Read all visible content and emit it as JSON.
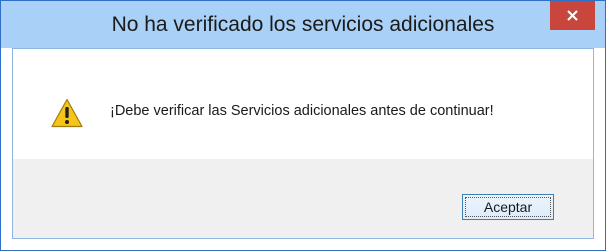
{
  "dialog": {
    "title": "No ha verificado los servicios adicionales",
    "message": "¡Debe verificar las Servicios adicionales antes de continuar!",
    "icon": "warning-icon",
    "ok_label": "Aceptar"
  },
  "colors": {
    "titlebar": "#a9d0f6",
    "close_button": "#c9463d",
    "footer": "#f0f0f0",
    "warning_yellow": "#f5c518"
  }
}
